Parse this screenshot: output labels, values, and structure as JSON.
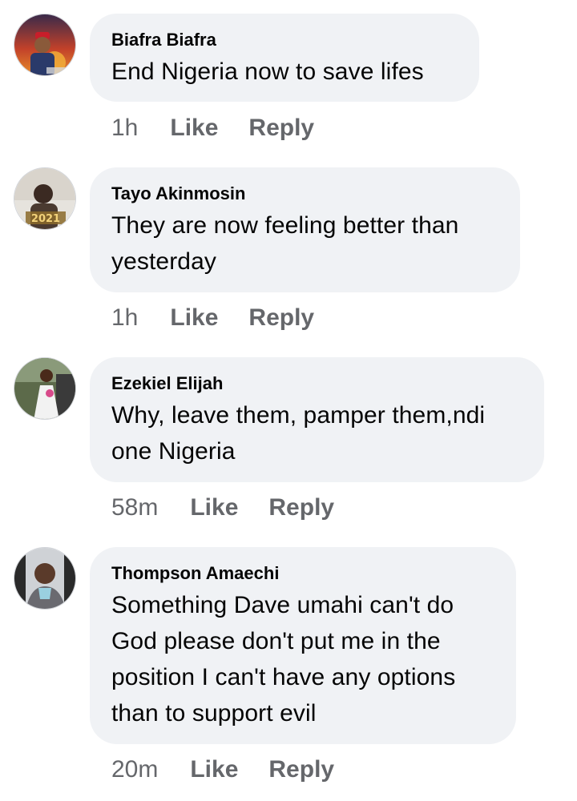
{
  "comments": [
    {
      "author": "Biafra Biafra",
      "lines": [
        "End Nigeria now to save lifes"
      ],
      "time": "1h",
      "like_label": "Like",
      "reply_label": "Reply",
      "avatar_caption": ""
    },
    {
      "author": "Tayo Akinmosin",
      "lines": [
        "They are now feeling better than",
        "yesterday"
      ],
      "time": "1h",
      "like_label": "Like",
      "reply_label": "Reply",
      "avatar_caption": "2021"
    },
    {
      "author": "Ezekiel Elijah",
      "lines": [
        "Why, leave them, pamper them,ndi",
        "one Nigeria"
      ],
      "time": "58m",
      "like_label": "Like",
      "reply_label": "Reply",
      "avatar_caption": ""
    },
    {
      "author": "Thompson Amaechi",
      "lines": [
        "Something Dave umahi can't do",
        "God please don't put me in the",
        "position I can't have any options",
        "than to support evil"
      ],
      "time": "20m",
      "like_label": "Like",
      "reply_label": "Reply",
      "avatar_caption": ""
    }
  ],
  "colors": {
    "bubble_background": "#f0f2f5",
    "author_text": "#050505",
    "meta_text": "#65676b"
  }
}
